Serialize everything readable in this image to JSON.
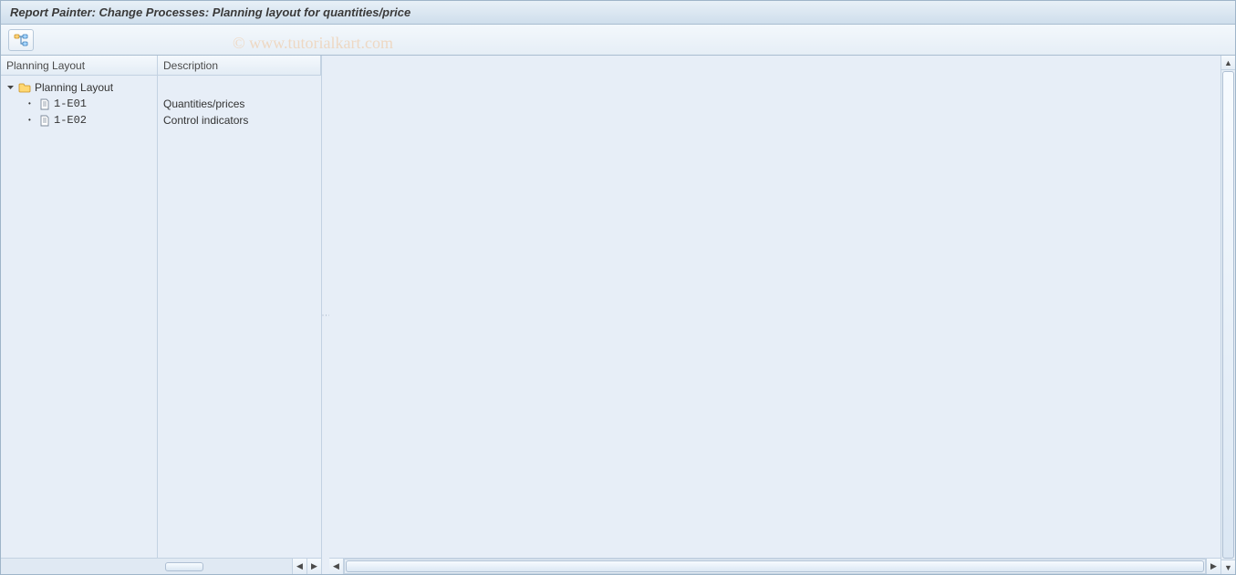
{
  "title": "Report Painter: Change Processes: Planning layout for quantities/price",
  "watermark": "© www.tutorialkart.com",
  "tree": {
    "columns": {
      "layout": "Planning Layout",
      "description": "Description"
    },
    "root": {
      "label": "Planning Layout",
      "description": ""
    },
    "items": [
      {
        "code": "1-E01",
        "description": "Quantities/prices"
      },
      {
        "code": "1-E02",
        "description": "Control indicators"
      }
    ]
  }
}
